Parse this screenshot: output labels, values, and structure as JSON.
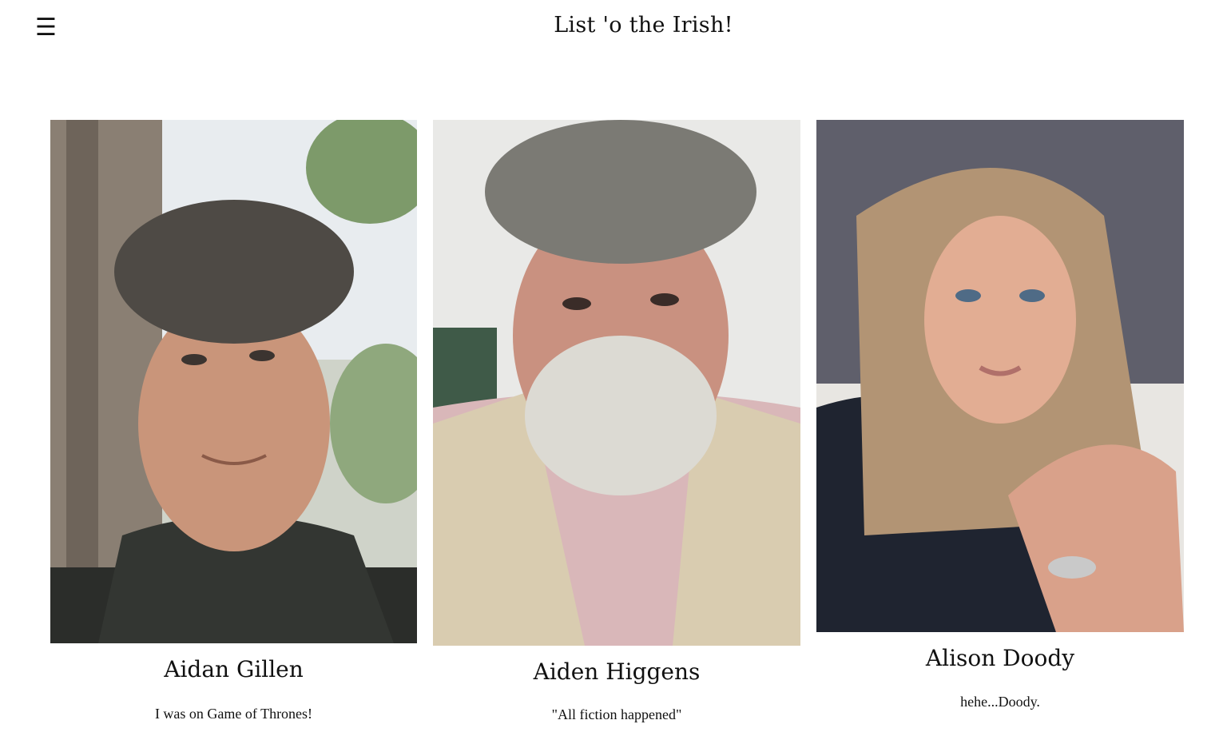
{
  "header": {
    "menu_icon": "hamburger-menu-icon",
    "menu_glyph": "☰",
    "title": "List 'o the Irish!"
  },
  "people": [
    {
      "name": "Aidan Gillen",
      "caption": "I was on Game of Thrones!",
      "photo_icon": "portrait-photo"
    },
    {
      "name": "Aiden Higgens",
      "caption": "\"All fiction happened\"",
      "photo_icon": "portrait-photo"
    },
    {
      "name": "Alison Doody",
      "caption": "hehe...Doody.",
      "photo_icon": "portrait-photo"
    }
  ]
}
